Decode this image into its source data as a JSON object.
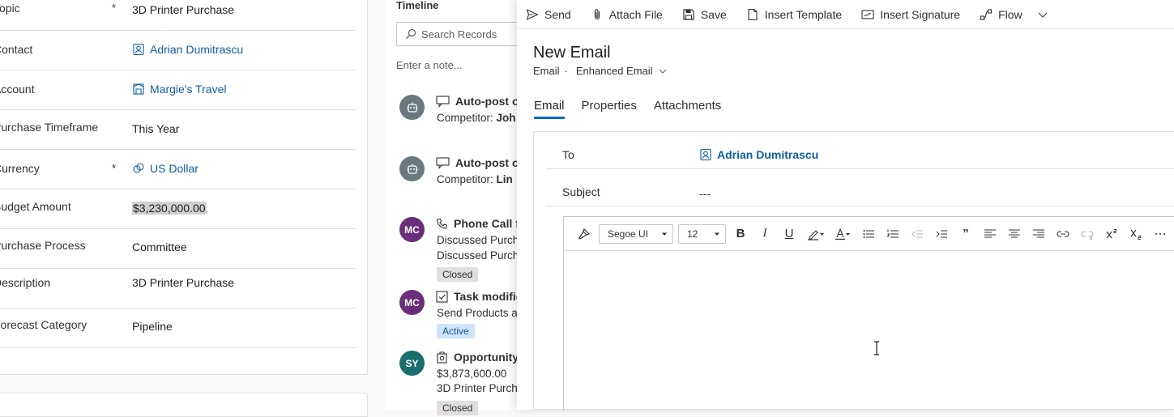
{
  "form": {
    "rows": [
      {
        "label": "Topic",
        "required": "*",
        "value": "3D Printer Purchase"
      },
      {
        "label": "Contact",
        "required": "",
        "value": "Adrian Dumitrascu",
        "icon": "contact-icon"
      },
      {
        "label": "Account",
        "required": "",
        "value": "Margie's Travel",
        "icon": "account-icon"
      },
      {
        "label": "Purchase Timeframe",
        "required": "",
        "value": "This Year"
      },
      {
        "label": "Currency",
        "required": "*",
        "value": "US Dollar",
        "icon": "currency-icon"
      },
      {
        "label": "Budget Amount",
        "required": "",
        "value": "$3,230,000.00"
      },
      {
        "label": "Purchase Process",
        "required": "",
        "value": "Committee"
      },
      {
        "label": "Description",
        "required": "",
        "value": "3D Printer Purchase"
      },
      {
        "label": "Forecast Category",
        "required": "",
        "value": "Pipeline"
      }
    ]
  },
  "timeline": {
    "title": "Timeline",
    "search_placeholder": "Search Records",
    "note_placeholder": "Enter a note...",
    "items": [
      {
        "avatar": "",
        "avatar_color": "#69797e",
        "title": "Auto-post o",
        "line1_prefix": "Competitor: ",
        "line1_bold": "Joh",
        "line2": "",
        "badge": ""
      },
      {
        "avatar": "",
        "avatar_color": "#69797e",
        "title": "Auto-post o",
        "line1_prefix": "Competitor: ",
        "line1_bold": "Lin",
        "line2": "",
        "badge": ""
      },
      {
        "avatar": "MC",
        "avatar_color": "#6b2e7a",
        "title": "Phone Call f",
        "line1_prefix": "Discussed Purch",
        "line1_bold": "",
        "line2": "Discussed Purch",
        "badge": "Closed"
      },
      {
        "avatar": "MC",
        "avatar_color": "#6b2e7a",
        "title": "Task modifie",
        "line1_prefix": "Send Products a",
        "line1_bold": "",
        "line2": "",
        "badge": "Active"
      },
      {
        "avatar": "SY",
        "avatar_color": "#1b6e6e",
        "title": "Opportunity",
        "line1_prefix": "$3,873,600.00",
        "line1_bold": "",
        "line2": "3D Printer Purch",
        "badge": "Closed"
      }
    ]
  },
  "email": {
    "commands": {
      "send": "Send",
      "attach": "Attach File",
      "save": "Save",
      "template": "Insert Template",
      "signature": "Insert Signature",
      "flow": "Flow"
    },
    "title": "New Email",
    "entity": "Email",
    "separator": "·",
    "form_name": "Enhanced Email",
    "tabs": [
      "Email",
      "Properties",
      "Attachments"
    ],
    "to_label": "To",
    "to_value": "Adrian Dumitrascu",
    "subject_label": "Subject",
    "subject_value": "---",
    "editor": {
      "font": "Segoe UI",
      "size": "12",
      "bold": "B",
      "italic": "I",
      "underline": "U",
      "quote": "”"
    }
  },
  "colors": {
    "link": "#115ea3",
    "accent": "#0f6cbd",
    "active_badge_bg": "#cfe4fa",
    "closed_badge_bg": "#e1dfdd"
  }
}
